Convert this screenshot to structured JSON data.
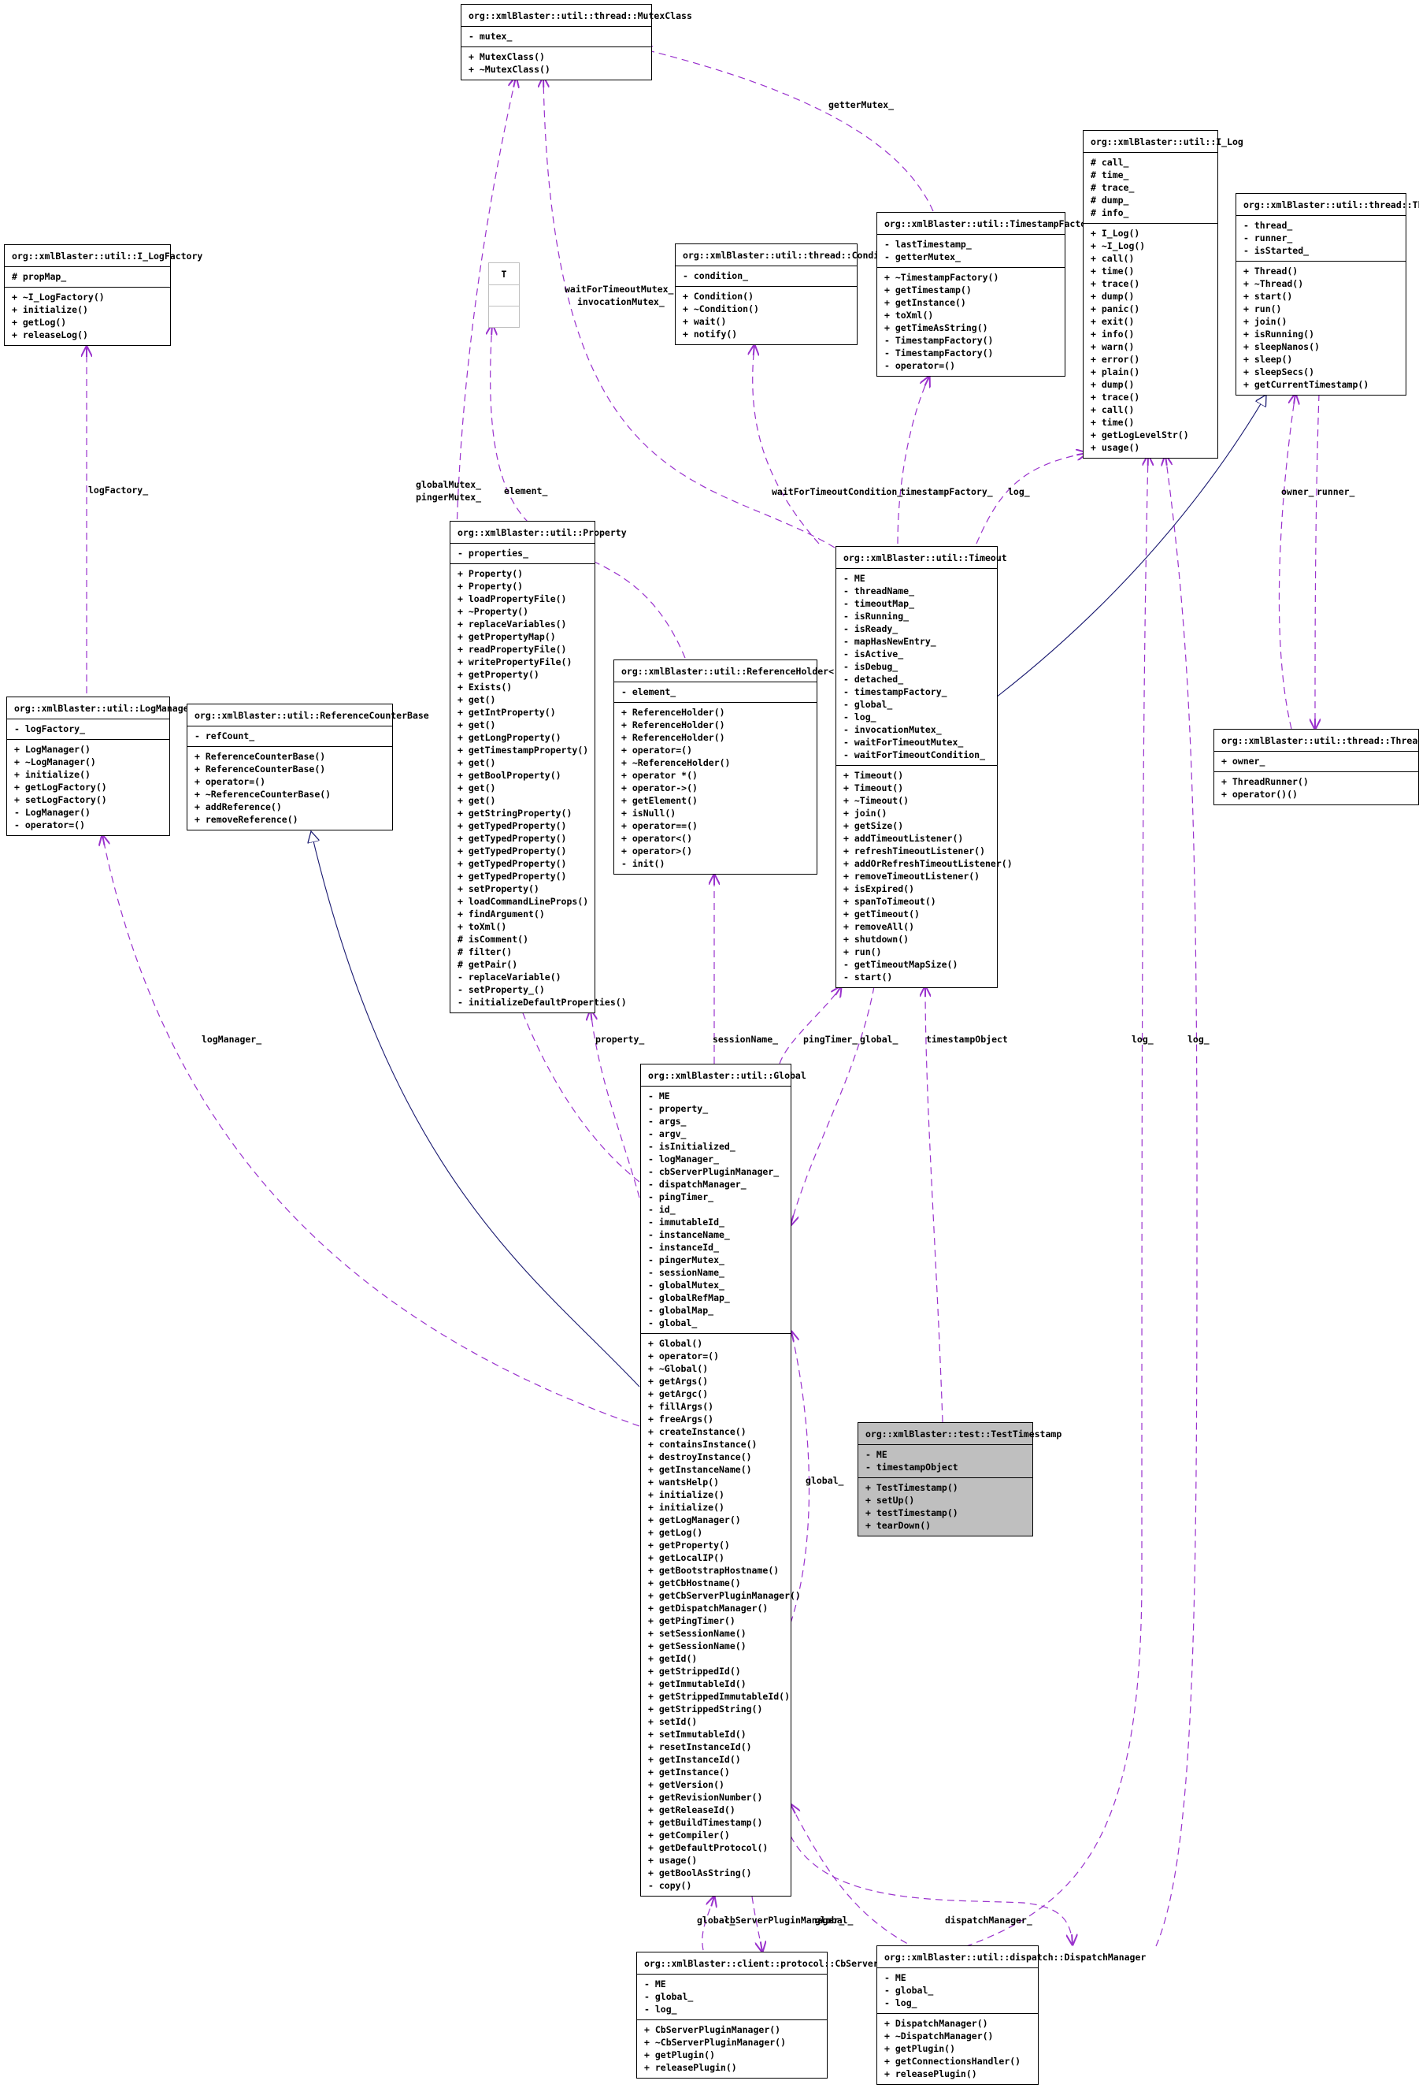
{
  "classes": {
    "mutex": {
      "title": "org::xmlBlaster::util::thread::MutexClass",
      "attrs": [
        "- mutex_"
      ],
      "ops": [
        "+ MutexClass()",
        "+ ~MutexClass()"
      ]
    },
    "ilogfactory": {
      "title": "org::xmlBlaster::util::I_LogFactory",
      "attrs": [
        "# propMap_"
      ],
      "ops": [
        "+ ~I_LogFactory()",
        "+ initialize()",
        "+ getLog()",
        "+ releaseLog()"
      ]
    },
    "tmpl": {
      "title": "T"
    },
    "condition": {
      "title": "org::xmlBlaster::util::thread::Condition",
      "attrs": [
        "- condition_"
      ],
      "ops": [
        "+ Condition()",
        "+ ~Condition()",
        "+ wait()",
        "+ notify()"
      ]
    },
    "tsfactory": {
      "title": "org::xmlBlaster::util::TimestampFactory",
      "attrs": [
        "- lastTimestamp_",
        "- getterMutex_"
      ],
      "ops": [
        "+ ~TimestampFactory()",
        "+ getTimestamp()",
        "+ getInstance()",
        "+ toXml()",
        "+ getTimeAsString()",
        "- TimestampFactory()",
        "- TimestampFactory()",
        "- operator=()"
      ]
    },
    "ilog": {
      "title": "org::xmlBlaster::util::I_Log",
      "attrs": [
        "# call_",
        "# time_",
        "# trace_",
        "# dump_",
        "# info_"
      ],
      "ops": [
        "+ I_Log()",
        "+ ~I_Log()",
        "+ call()",
        "+ time()",
        "+ trace()",
        "+ dump()",
        "+ panic()",
        "+ exit()",
        "+ info()",
        "+ warn()",
        "+ error()",
        "+ plain()",
        "+ dump()",
        "+ trace()",
        "+ call()",
        "+ time()",
        "+ getLogLevelStr()",
        "+ usage()"
      ]
    },
    "thread": {
      "title": "org::xmlBlaster::util::thread::Thread",
      "attrs": [
        "- thread_",
        "- runner_",
        "- isStarted_"
      ],
      "ops": [
        "+ Thread()",
        "+ ~Thread()",
        "+ start()",
        "+ run()",
        "+ join()",
        "+ isRunning()",
        "+ sleepNanos()",
        "+ sleep()",
        "+ sleepSecs()",
        "+ getCurrentTimestamp()"
      ]
    },
    "logmanager": {
      "title": "org::xmlBlaster::util::LogManager",
      "attrs": [
        "- logFactory_"
      ],
      "ops": [
        "+ LogManager()",
        "+ ~LogManager()",
        "+ initialize()",
        "+ getLogFactory()",
        "+ setLogFactory()",
        "- LogManager()",
        "- operator=()"
      ]
    },
    "refcounter": {
      "title": "org::xmlBlaster::util::ReferenceCounterBase",
      "attrs": [
        "- refCount_"
      ],
      "ops": [
        "+ ReferenceCounterBase()",
        "+ ReferenceCounterBase()",
        "+ operator=()",
        "+ ~ReferenceCounterBase()",
        "+ addReference()",
        "+ removeReference()"
      ]
    },
    "property": {
      "title": "org::xmlBlaster::util::Property",
      "attrs": [
        "- properties_"
      ],
      "ops": [
        "+ Property()",
        "+ Property()",
        "+ loadPropertyFile()",
        "+ ~Property()",
        "+ replaceVariables()",
        "+ getPropertyMap()",
        "+ readPropertyFile()",
        "+ writePropertyFile()",
        "+ getProperty()",
        "+ Exists()",
        "+ get()",
        "+ getIntProperty()",
        "+ get()",
        "+ getLongProperty()",
        "+ getTimestampProperty()",
        "+ get()",
        "+ getBoolProperty()",
        "+ get()",
        "+ get()",
        "+ getStringProperty()",
        "+ getTypedProperty()",
        "+ getTypedProperty()",
        "+ getTypedProperty()",
        "+ getTypedProperty()",
        "+ getTypedProperty()",
        "+ setProperty()",
        "+ loadCommandLineProps()",
        "+ findArgument()",
        "+ toXml()",
        "# isComment()",
        "# filter()",
        "# getPair()",
        "- replaceVariable()",
        "- setProperty_()",
        "- initializeDefaultProperties()"
      ]
    },
    "refholder": {
      "title": "org::xmlBlaster::util::ReferenceHolder< T >",
      "attrs": [
        "- element_"
      ],
      "ops": [
        "+ ReferenceHolder()",
        "+ ReferenceHolder()",
        "+ ReferenceHolder()",
        "+ operator=()",
        "+ ~ReferenceHolder()",
        "+ operator *()",
        "+ operator->()",
        "+ getElement()",
        "+ isNull()",
        "+ operator==()",
        "+ operator<()",
        "+ operator>()",
        "- init()"
      ]
    },
    "timeout": {
      "title": "org::xmlBlaster::util::Timeout",
      "attrs": [
        "- ME",
        "- threadName_",
        "- timeoutMap_",
        "- isRunning_",
        "- isReady_",
        "- mapHasNewEntry_",
        "- isActive_",
        "- isDebug_",
        "- detached_",
        "- timestampFactory_",
        "- global_",
        "- log_",
        "- invocationMutex_",
        "- waitForTimeoutMutex_",
        "- waitForTimeoutCondition_"
      ],
      "ops": [
        "+ Timeout()",
        "+ Timeout()",
        "+ ~Timeout()",
        "+ join()",
        "+ getSize()",
        "+ addTimeoutListener()",
        "+ refreshTimeoutListener()",
        "+ addOrRefreshTimeoutListener()",
        "+ removeTimeoutListener()",
        "+ isExpired()",
        "+ spanToTimeout()",
        "+ getTimeout()",
        "+ removeAll()",
        "+ shutdown()",
        "+ run()",
        "- getTimeoutMapSize()",
        "- start()"
      ]
    },
    "threadrunner": {
      "title": "org::xmlBlaster::util::thread::ThreadRunner",
      "attrs": [
        "+ owner_"
      ],
      "ops": [
        "+ ThreadRunner()",
        "+ operator()()"
      ]
    },
    "global": {
      "title": "org::xmlBlaster::util::Global",
      "attrs": [
        "- ME",
        "- property_",
        "- args_",
        "- argv_",
        "- isInitialized_",
        "- logManager_",
        "- cbServerPluginManager_",
        "- dispatchManager_",
        "- pingTimer_",
        "- id_",
        "- immutableId_",
        "- instanceName_",
        "- instanceId_",
        "- pingerMutex_",
        "- sessionName_",
        "- globalMutex_",
        "- globalRefMap_",
        "- globalMap_",
        "- global_"
      ],
      "ops": [
        "+ Global()",
        "+ operator=()",
        "+ ~Global()",
        "+ getArgs()",
        "+ getArgc()",
        "+ fillArgs()",
        "+ freeArgs()",
        "+ createInstance()",
        "+ containsInstance()",
        "+ destroyInstance()",
        "+ getInstanceName()",
        "+ wantsHelp()",
        "+ initialize()",
        "+ initialize()",
        "+ getLogManager()",
        "+ getLog()",
        "+ getProperty()",
        "+ getLocalIP()",
        "+ getBootstrapHostname()",
        "+ getCbHostname()",
        "+ getCbServerPluginManager()",
        "+ getDispatchManager()",
        "+ getPingTimer()",
        "+ setSessionName()",
        "+ getSessionName()",
        "+ getId()",
        "+ getStrippedId()",
        "+ getImmutableId()",
        "+ getStrippedImmutableId()",
        "+ getStrippedString()",
        "+ setId()",
        "+ setImmutableId()",
        "+ resetInstanceId()",
        "+ getInstanceId()",
        "+ getInstance()",
        "+ getVersion()",
        "+ getRevisionNumber()",
        "+ getReleaseId()",
        "+ getBuildTimestamp()",
        "+ getCompiler()",
        "+ getDefaultProtocol()",
        "+ usage()",
        "+ getBoolAsString()",
        "- copy()"
      ]
    },
    "testts": {
      "title": "org::xmlBlaster::test::TestTimestamp",
      "attrs": [
        "- ME",
        "- timestampObject"
      ],
      "ops": [
        "+ TestTimestamp()",
        "+ setUp()",
        "+ testTimestamp()",
        "+ tearDown()"
      ]
    },
    "cbspm": {
      "title": "org::xmlBlaster::client::protocol::CbServerPluginManager",
      "attrs": [
        "- ME",
        "- global_",
        "- log_"
      ],
      "ops": [
        "+ CbServerPluginManager()",
        "+ ~CbServerPluginManager()",
        "+ getPlugin()",
        "+ releasePlugin()"
      ]
    },
    "dispatch": {
      "title": "org::xmlBlaster::util::dispatch::DispatchManager",
      "attrs": [
        "- ME",
        "- global_",
        "- log_"
      ],
      "ops": [
        "+ DispatchManager()",
        "+ ~DispatchManager()",
        "+ getPlugin()",
        "+ getConnectionsHandler()",
        "+ releasePlugin()"
      ]
    }
  },
  "edge_labels": {
    "getterMutex": "getterMutex_",
    "logFactory": "logFactory_",
    "waitForTimeoutMutex": "waitForTimeoutMutex_",
    "invocationMutex": "invocationMutex_",
    "globalMutex": "globalMutex_",
    "pingerMutex": "pingerMutex_",
    "element": "element_",
    "waitForTimeoutCondition": "waitForTimeoutCondition_",
    "timestampFactory": "timestampFactory_",
    "log_timeout": "log_",
    "owner": "owner_",
    "runner": "runner_",
    "logManager": "logManager_",
    "property": "property_",
    "sessionName": "sessionName_",
    "pingTimer": "pingTimer_",
    "global_timeout": "global_",
    "timestampObject": "timestampObject",
    "log_cbspm": "log_",
    "log_dispatch": "log_",
    "global_self": "global_",
    "global_cbspm": "global_",
    "cbServerPluginManager": "cbServerPluginManager_",
    "global_dispatch": "global_",
    "dispatchManager": "dispatchManager_"
  },
  "colors": {
    "usage_edge": "#9a32cd",
    "inherit_edge": "#191970",
    "focus_class_bg": "#bfbfbf"
  }
}
